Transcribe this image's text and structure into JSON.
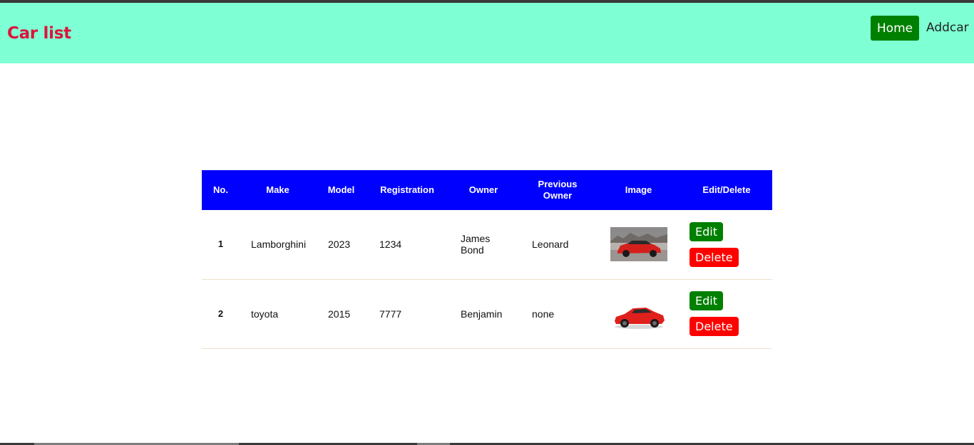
{
  "navbar": {
    "brand": "Car list",
    "home_label": "Home",
    "addcar_label": "Addcar"
  },
  "table": {
    "headers": [
      "No.",
      "Make",
      "Model",
      "Registration",
      "Owner",
      "Previous Owner",
      "Image",
      "Edit/Delete"
    ],
    "rows": [
      {
        "no": "1",
        "make": "Lamborghini",
        "model": "2023",
        "registration": "1234",
        "owner": "James Bond",
        "previous_owner": "Leonard",
        "image": "red-suv-photo",
        "edit": "Edit",
        "delete": "Delete"
      },
      {
        "no": "2",
        "make": "toyota",
        "model": "2015",
        "registration": "7777",
        "owner": "Benjamin",
        "previous_owner": "none",
        "image": "red-coupe-photo",
        "edit": "Edit",
        "delete": "Delete"
      }
    ]
  },
  "colors": {
    "navbar_bg": "#7fffd4",
    "brand": "#dc143c",
    "header_bg": "#0000ff",
    "edit": "#008000",
    "delete": "#ff0000"
  }
}
